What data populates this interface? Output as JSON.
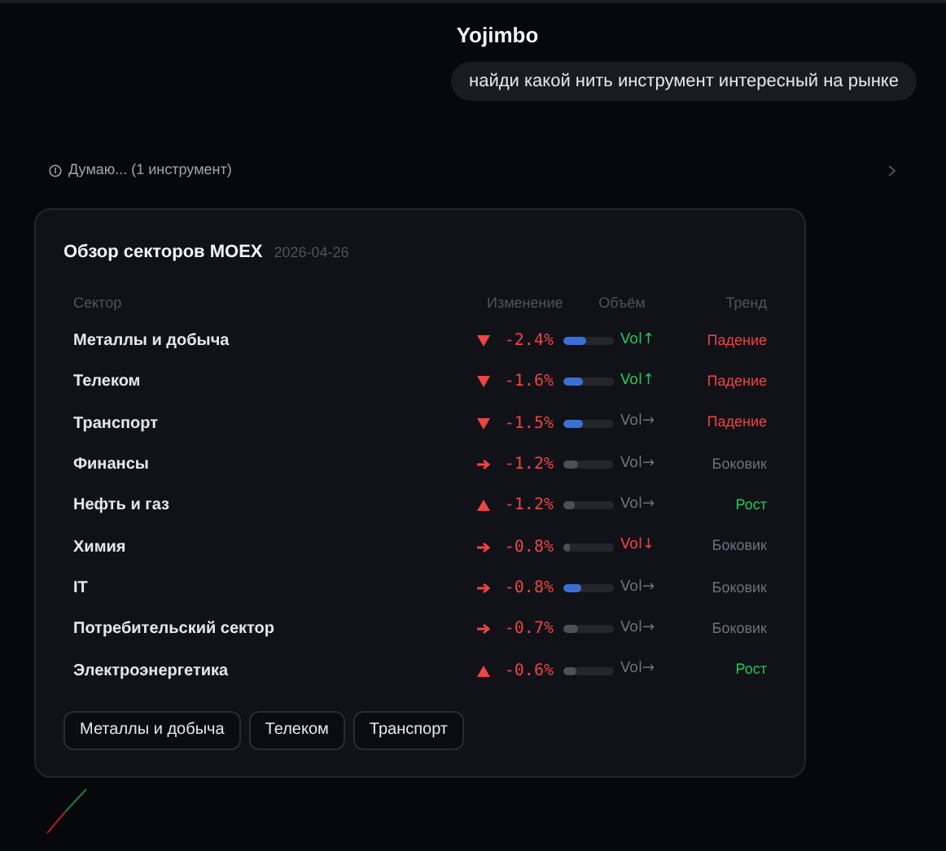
{
  "header": {
    "title": "Yojimbo"
  },
  "user_message": "найди какой нить инструмент интересный на рынке",
  "thinking": {
    "label": "Думаю... (1 инструмент)",
    "expanded": false
  },
  "card": {
    "title": "Обзор секторов MOEX",
    "date": "2026-04-26",
    "columns": [
      "Сектор",
      "Изменение",
      "Объём",
      "Тренд"
    ],
    "rows": [
      {
        "name": "Металлы и добыча",
        "change": {
          "kind": "down",
          "text": "-2.4%"
        },
        "level": 0.45,
        "highlight": true,
        "volume": {
          "kind": "up",
          "text": "Vol↑"
        },
        "trend": {
          "kind": "fall",
          "text": "Падение"
        }
      },
      {
        "name": "Телеком",
        "change": {
          "kind": "down",
          "text": "-1.6%"
        },
        "level": 0.4,
        "highlight": true,
        "volume": {
          "kind": "up",
          "text": "Vol↑"
        },
        "trend": {
          "kind": "fall",
          "text": "Падение"
        }
      },
      {
        "name": "Транспорт",
        "change": {
          "kind": "down",
          "text": "-1.5%"
        },
        "level": 0.38,
        "highlight": true,
        "volume": {
          "kind": "flat",
          "text": "Vol→"
        },
        "trend": {
          "kind": "fall",
          "text": "Падение"
        }
      },
      {
        "name": "Финансы",
        "change": {
          "kind": "right",
          "text": "-1.2%"
        },
        "level": 0.3,
        "highlight": false,
        "volume": {
          "kind": "flat",
          "text": "Vol→"
        },
        "trend": {
          "kind": "flat",
          "text": "Боковик"
        }
      },
      {
        "name": "Нефть и газ",
        "change": {
          "kind": "up",
          "text": "-1.2%"
        },
        "level": 0.22,
        "highlight": false,
        "volume": {
          "kind": "flat",
          "text": "Vol→"
        },
        "trend": {
          "kind": "rise",
          "text": "Рост"
        }
      },
      {
        "name": "Химия",
        "change": {
          "kind": "right",
          "text": "-0.8%"
        },
        "level": 0.12,
        "highlight": false,
        "volume": {
          "kind": "down",
          "text": "Vol↓"
        },
        "trend": {
          "kind": "flat",
          "text": "Боковик"
        }
      },
      {
        "name": "IT",
        "change": {
          "kind": "right",
          "text": "-0.8%"
        },
        "level": 0.35,
        "highlight": true,
        "volume": {
          "kind": "flat",
          "text": "Vol→"
        },
        "trend": {
          "kind": "flat",
          "text": "Боковик"
        }
      },
      {
        "name": "Потребительский сектор",
        "change": {
          "kind": "right",
          "text": "-0.7%"
        },
        "level": 0.3,
        "highlight": false,
        "volume": {
          "kind": "flat",
          "text": "Vol→"
        },
        "trend": {
          "kind": "flat",
          "text": "Боковик"
        }
      },
      {
        "name": "Электроэнергетика",
        "change": {
          "kind": "up",
          "text": "-0.6%"
        },
        "level": 0.25,
        "highlight": false,
        "volume": {
          "kind": "flat",
          "text": "Vol→"
        },
        "trend": {
          "kind": "rise",
          "text": "Рост"
        }
      }
    ],
    "buttons": [
      "Металлы и добыча",
      "Телеком",
      "Транспорт"
    ]
  }
}
